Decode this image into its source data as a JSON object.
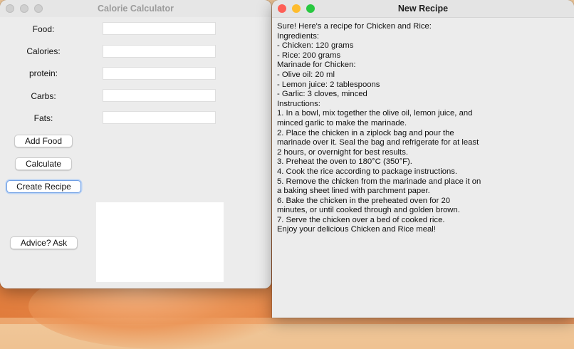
{
  "calc_window": {
    "title": "Calorie Calculator",
    "labels": {
      "food": "Food:",
      "calories": "Calories:",
      "protein": "protein:",
      "carbs": "Carbs:",
      "fats": "Fats:"
    },
    "buttons": {
      "add_food": "Add Food",
      "calculate": "Calculate",
      "create_recipe": "Create Recipe",
      "advice": "Advice? Ask"
    }
  },
  "recipe_window": {
    "title": "New Recipe",
    "lines": [
      "Sure! Here's a recipe for Chicken and Rice:",
      "Ingredients:",
      "- Chicken: 120 grams",
      "- Rice: 200 grams",
      "Marinade for Chicken:",
      "- Olive oil: 20 ml",
      "- Lemon juice: 2 tablespoons",
      "- Garlic: 3 cloves, minced",
      "Instructions:",
      "1. In a bowl, mix together the olive oil, lemon juice, and",
      "minced garlic to make the marinade.",
      "2. Place the chicken in a ziplock bag and pour the",
      "marinade over it. Seal the bag and refrigerate for at least",
      "2 hours, or overnight for best results.",
      "3. Preheat the oven to 180°C (350°F).",
      "4. Cook the rice according to package instructions.",
      "5. Remove the chicken from the marinade and place it on",
      "a baking sheet lined with parchment paper.",
      "6. Bake the chicken in the preheated oven for 20",
      "minutes, or until cooked through and golden brown.",
      "7. Serve the chicken over a bed of cooked rice.",
      "Enjoy your delicious Chicken and Rice meal!"
    ]
  },
  "colors": {
    "close": "#fe5f57",
    "minimize": "#febc2e",
    "zoom": "#28c840",
    "focus_ring": "#6f9fe4"
  }
}
